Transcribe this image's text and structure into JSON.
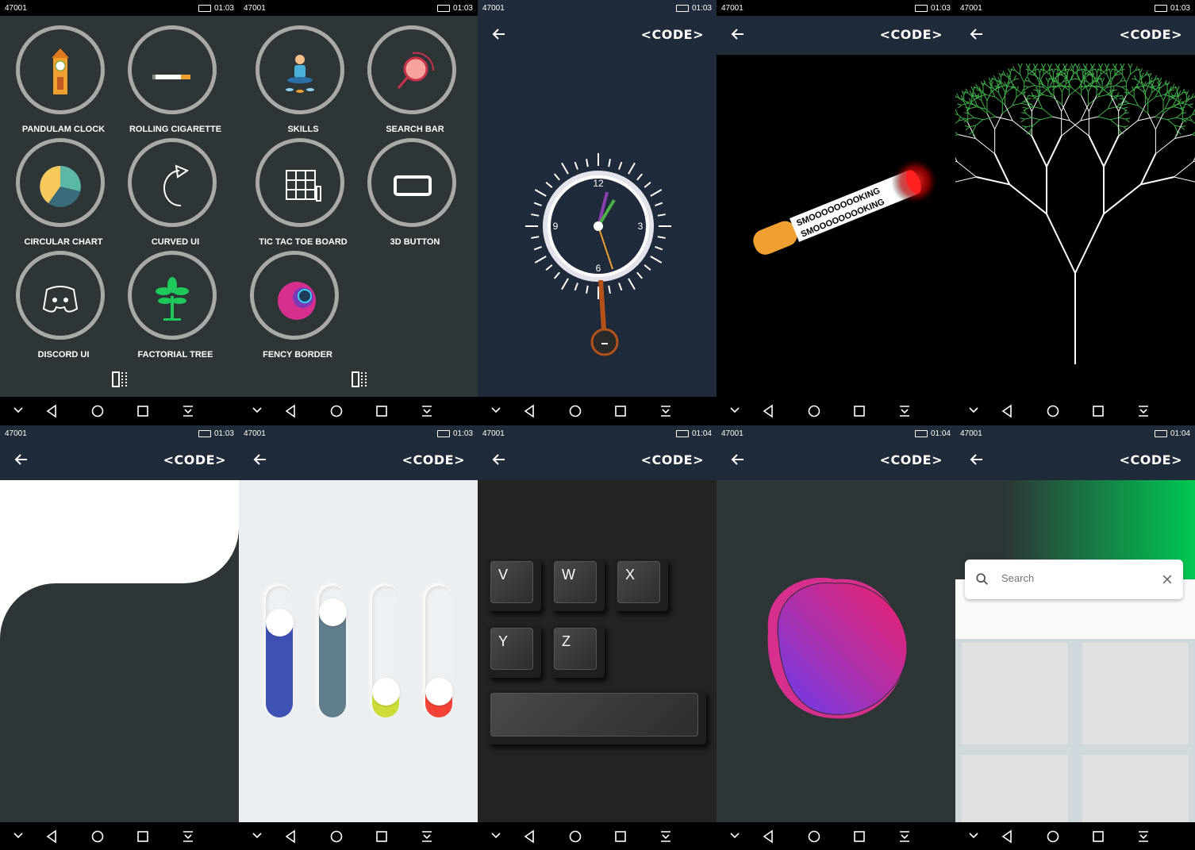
{
  "status": {
    "carrier": "47001",
    "time_a": "01:03",
    "time_b": "01:04"
  },
  "appbar": {
    "title": "<CODE>"
  },
  "menu_left": [
    {
      "label": "PANDULAM CLOCK",
      "icon": "pendulum-clock-icon"
    },
    {
      "label": "ROLLING CIGARETTE",
      "icon": "cigarette-icon"
    },
    {
      "label": "CIRCULAR CHART",
      "icon": "pie-chart-icon"
    },
    {
      "label": "CURVED UI",
      "icon": "curved-arrow-icon"
    },
    {
      "label": "DISCORD UI",
      "icon": "discord-icon"
    },
    {
      "label": "FACTORIAL TREE",
      "icon": "tree-icon"
    }
  ],
  "menu_right": [
    {
      "label": "SKILLS",
      "icon": "meditation-icon"
    },
    {
      "label": "SEARCH BAR",
      "icon": "search-icon"
    },
    {
      "label": "TIC TAC TOE BOARD",
      "icon": "tic-tac-toe-icon"
    },
    {
      "label": "3D BUTTON",
      "icon": "button-icon"
    },
    {
      "label": "FENCY BORDER",
      "icon": "fancy-circle-icon"
    }
  ],
  "clock": {
    "numbers": [
      "12",
      "3",
      "6",
      "9"
    ]
  },
  "cigarette": {
    "text": "SMOOOOOOOOKING"
  },
  "sliders": [
    {
      "color": "#3f51b5",
      "level": 0.72
    },
    {
      "color": "#607d8b",
      "level": 0.8
    },
    {
      "color": "#cddc39",
      "level": 0.2
    },
    {
      "color": "#f44336",
      "level": 0.2
    }
  ],
  "keyboard": {
    "keys": [
      "V",
      "W",
      "X",
      "Y",
      "Z"
    ]
  },
  "search": {
    "placeholder": "Search"
  },
  "colors": {
    "appbar": "#202b3a",
    "menu_bg": "#2d3537",
    "ring": "#a9a9a9",
    "search_gradient": "#00c853"
  }
}
